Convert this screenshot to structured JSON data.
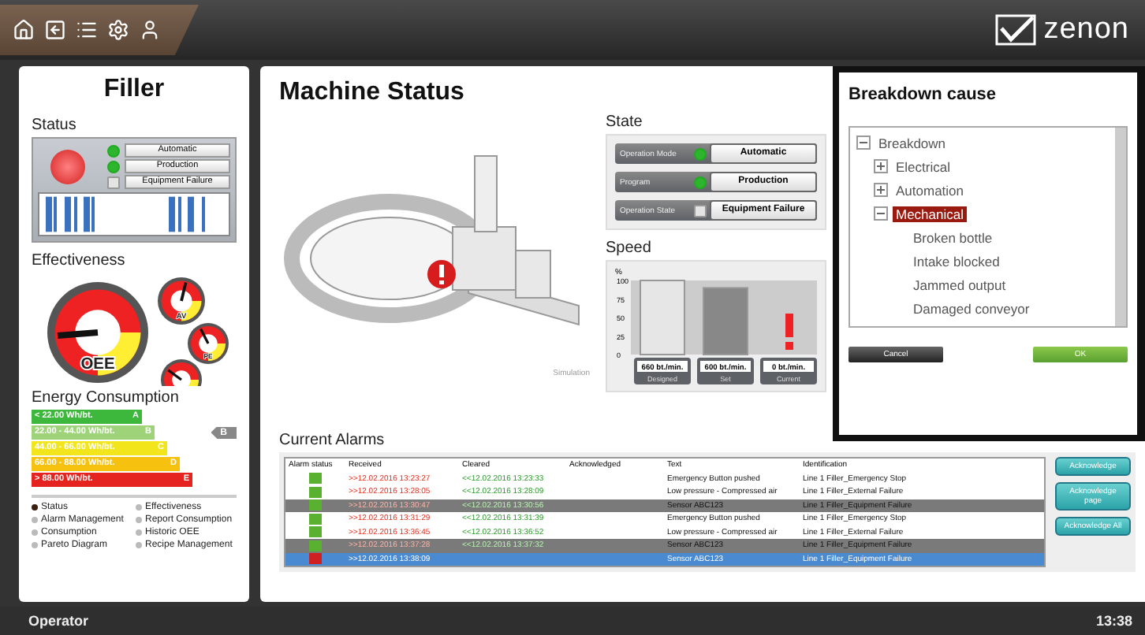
{
  "top_bar": {
    "brand": "zenon"
  },
  "filler": {
    "title": "Filler",
    "status": {
      "heading": "Status",
      "alarm_on": true,
      "rows": [
        {
          "label": "Automatic",
          "on": true
        },
        {
          "label": "Production",
          "on": true
        },
        {
          "label": "Equipment Failure",
          "on": false
        }
      ]
    },
    "effectiveness": {
      "heading": "Effectiveness",
      "gauges": [
        {
          "label": "OEE"
        },
        {
          "label": "AV"
        },
        {
          "label": "PE"
        }
      ]
    },
    "energy": {
      "heading": "Energy Consumption",
      "classes": [
        {
          "range": "< 22.00 Wh/bt.",
          "grade": "A",
          "color": "#3db83d",
          "selected": false
        },
        {
          "range": "22.00 - 44.00 Wh/bt.",
          "grade": "B",
          "color": "#9fd37a",
          "selected": true
        },
        {
          "range": "44.00 - 66.00 Wh/bt.",
          "grade": "C",
          "color": "#f2e51c",
          "selected": false
        },
        {
          "range": "66.00 - 88.00 Wh/bt.",
          "grade": "D",
          "color": "#f7c20f",
          "selected": false
        },
        {
          "range": "> 88.00 Wh/bt.",
          "grade": "E",
          "color": "#e52420",
          "selected": false
        }
      ],
      "current_grade": "B"
    },
    "nav": [
      {
        "label": "Status",
        "selected": true
      },
      {
        "label": "Effectiveness",
        "selected": false
      },
      {
        "label": "Alarm Management",
        "selected": false
      },
      {
        "label": "Report Consumption",
        "selected": false
      },
      {
        "label": "Consumption",
        "selected": false
      },
      {
        "label": "Historic OEE",
        "selected": false
      },
      {
        "label": "Pareto Diagram",
        "selected": false
      },
      {
        "label": "Recipe Management",
        "selected": false
      }
    ]
  },
  "machine": {
    "title": "Machine Status",
    "simulation_label": "Simulation",
    "failure": true,
    "state": {
      "heading": "State",
      "rows": [
        {
          "name": "Operation Mode",
          "on": true,
          "value": "Automatic"
        },
        {
          "name": "Program",
          "on": true,
          "value": "Production"
        },
        {
          "name": "Operation State",
          "on": false,
          "value": "Equipment Failure"
        }
      ]
    },
    "speed": {
      "heading": "Speed",
      "warning": true,
      "chart_data": {
        "type": "bar",
        "ylabel": "%",
        "categories": [
          "Designed",
          "Set",
          "Current"
        ],
        "values": [
          100,
          90,
          0
        ],
        "yticks": [
          0,
          25,
          50,
          75,
          100
        ],
        "ylim": [
          0,
          100
        ]
      },
      "readouts": [
        "660 bt./min.",
        "600 bt./min.",
        "0 bt./min."
      ]
    }
  },
  "alarms": {
    "heading": "Current Alarms",
    "columns": [
      "Alarm status",
      "Received",
      "Cleared",
      "Acknowledged",
      "Text",
      "Identification"
    ],
    "rows": [
      {
        "kind": "cleared",
        "received": ">>12.02.2016 13:23:27",
        "cleared": "<<12.02.2016 13:23:33",
        "text": "Emergency Button pushed",
        "identification": "Line 1 Filler_Emergency Stop",
        "shaded": false,
        "selected": false
      },
      {
        "kind": "cleared",
        "received": ">>12.02.2016 13:28:05",
        "cleared": "<<12.02.2016 13:28:09",
        "text": "Low pressure - Compressed air",
        "identification": "Line 1 Filler_External Failure",
        "shaded": false,
        "selected": false
      },
      {
        "kind": "cleared",
        "received": ">>12.02.2016 13:30:47",
        "cleared": "<<12.02.2016 13:30:56",
        "text": "Sensor ABC123",
        "identification": "Line 1 Filler_Equipment Failure",
        "shaded": true,
        "selected": false
      },
      {
        "kind": "cleared",
        "received": ">>12.02.2016 13:31:29",
        "cleared": "<<12.02.2016 13:31:39",
        "text": "Emergency Button pushed",
        "identification": "Line 1 Filler_Emergency Stop",
        "shaded": false,
        "selected": false
      },
      {
        "kind": "cleared",
        "received": ">>12.02.2016 13:36:45",
        "cleared": "<<12.02.2016 13:36:52",
        "text": "Low pressure - Compressed air",
        "identification": "Line 1 Filler_External Failure",
        "shaded": false,
        "selected": false
      },
      {
        "kind": "cleared",
        "received": ">>12.02.2016 13:37:28",
        "cleared": "<<12.02.2016 13:37:32",
        "text": "Sensor ABC123",
        "identification": "Line 1 Filler_Equipment Failure",
        "shaded": true,
        "selected": false
      },
      {
        "kind": "active",
        "received": ">>12.02.2016 13:38:09",
        "cleared": "",
        "text": "Sensor ABC123",
        "identification": "Line 1 Filler_Equipment Failure",
        "shaded": false,
        "selected": true
      }
    ],
    "buttons": [
      "Acknowledge",
      "Acknowledge page",
      "Acknowledge All"
    ]
  },
  "dialog": {
    "title": "Breakdown cause",
    "tree": [
      {
        "label": "Breakdown",
        "expanded": true,
        "selected": false,
        "children": [
          {
            "label": "Electrical",
            "expanded": false,
            "selected": false
          },
          {
            "label": "Automation",
            "expanded": false,
            "selected": false
          },
          {
            "label": "Mechanical",
            "expanded": true,
            "selected": true,
            "children": [
              {
                "label": "Broken bottle",
                "selected": false
              },
              {
                "label": "Intake blocked",
                "selected": false
              },
              {
                "label": "Jammed output",
                "selected": false
              },
              {
                "label": "Damaged conveyor",
                "selected": false
              }
            ]
          }
        ]
      }
    ],
    "buttons": [
      {
        "label": "Cancel",
        "kind": "cancel"
      },
      {
        "label": "OK",
        "kind": "ok"
      }
    ]
  },
  "status_bar": {
    "user": "Operator",
    "time": "13:38"
  }
}
